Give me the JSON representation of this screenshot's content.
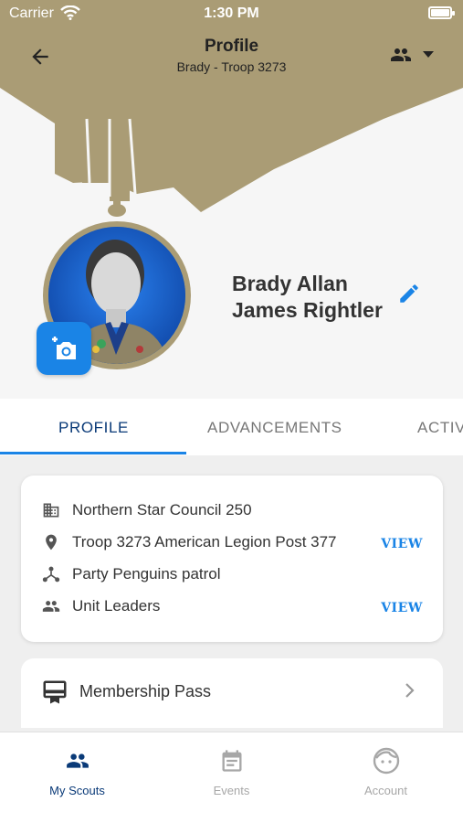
{
  "status_bar": {
    "carrier": "Carrier",
    "time": "1:30 PM",
    "battery_level": 1.0
  },
  "header": {
    "title": "Profile",
    "subtitle": "Brady - Troop 3273"
  },
  "profile": {
    "name_line1": "Brady Allan",
    "name_line2": "James Rightler"
  },
  "tabs": [
    {
      "label": "PROFILE",
      "active": true
    },
    {
      "label": "ADVANCEMENTS",
      "active": false
    },
    {
      "label": "ACTIV",
      "active": false
    }
  ],
  "info": {
    "council": "Northern Star Council 250",
    "unit": "Troop 3273 American Legion Post 377",
    "unit_view": "VIEW",
    "patrol": "Party Penguins patrol",
    "leaders": "Unit Leaders",
    "leaders_view": "VIEW"
  },
  "membership": {
    "label": "Membership Pass"
  },
  "bottom_nav": [
    {
      "label": "My Scouts",
      "icon": "people-icon",
      "active": true
    },
    {
      "label": "Events",
      "icon": "calendar-icon",
      "active": false
    },
    {
      "label": "Account",
      "icon": "face-icon",
      "active": false
    }
  ],
  "colors": {
    "khaki": "#aa9c75",
    "accent": "#1a84e6",
    "navy": "#0a3a78"
  }
}
